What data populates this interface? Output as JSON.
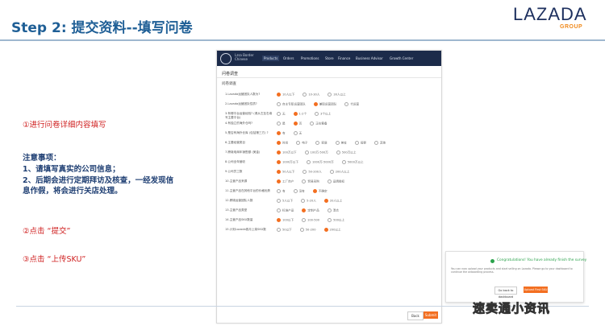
{
  "slide": {
    "title": "Step 2: 提交资料--填写问卷",
    "logo_word": "LAZADA",
    "logo_sub": "GROUP",
    "step1": "①进行问卷详细内容填写",
    "notes_heading": "注意事项：",
    "note1": "1、请填写真实的公司信息；",
    "note2_line1": "2、后期会进行定期拜访及核查，一经发现信",
    "note2_line2": "息作假，将会进行关店处理。",
    "step2": "②点击 “提交”",
    "step3": "③点击 “上传SKU”",
    "watermark": "速卖通小资讯"
  },
  "screenshot": {
    "shop_name_line1": "Lzsa Border",
    "shop_name_line2": "Chinese",
    "nav": [
      {
        "label": "Products",
        "active": true
      },
      {
        "label": "Orders",
        "active": false
      },
      {
        "label": "Promotions",
        "active": false
      },
      {
        "label": "Store",
        "active": false
      },
      {
        "label": "Finance",
        "active": false
      },
      {
        "label": "Business Advisor",
        "active": false
      },
      {
        "label": "Growth Center",
        "active": false
      }
    ],
    "page_title": "问卷调查",
    "section_title": "问卷调查",
    "questions": [
      {
        "label": "1.Lazada运营团队人数为?",
        "options": [
          "10人以下",
          "10-30人",
          "30人以上"
        ],
        "selected": 0
      },
      {
        "label": "2.Lazada运营团队性质?",
        "options": [
          "自主专职运营团队",
          "兼职运营团队",
          "代运营"
        ],
        "selected": 1
      },
      {
        "label": "3.有哪平台运营经验? (请从左至右填写主要平台)",
        "options": [
          "无",
          "1-2个",
          "3个以上"
        ],
        "selected": 1
      },
      {
        "label": "4.有独立的海外仓吗?",
        "options": [
          "是",
          "否",
          "正在筹备"
        ],
        "selected": 1
      },
      {
        "label": "5.是否有海外仓库 (包括第三方) ?",
        "options": [
          "有",
          "无"
        ],
        "selected": 0
      },
      {
        "label": "6.主要经营类目",
        "options": [
          "时尚",
          "电子",
          "家居",
          "美妆",
          "母婴",
          "其他"
        ],
        "selected": 0
      },
      {
        "label": "7.跨境电商年销售额 (美金)",
        "options": [
          "100万以下",
          "100万-500万",
          "500万以上"
        ],
        "selected": 0
      },
      {
        "label": "8.公司全年营收",
        "options": [
          "1000万以下",
          "1000万-5000万",
          "5000万以上"
        ],
        "selected": 0
      },
      {
        "label": "9.公司员工数",
        "options": [
          "50人以下",
          "50-200人",
          "200人以上"
        ],
        "selected": 0
      },
      {
        "label": "10.主营产品来源",
        "options": [
          "工厂自产",
          "贸易采购",
          "品牌授权"
        ],
        "selected": 0
      },
      {
        "label": "11.主营产品在其他平台的价格优势",
        "options": [
          "有",
          "没有",
          "不确定"
        ],
        "selected": 2
      },
      {
        "label": "12.跨境运营团队人数",
        "options": [
          "5人以下",
          "5-20人",
          "20人以上"
        ],
        "selected": 2
      },
      {
        "label": "13.主营产品类型",
        "options": [
          "标准产品",
          "定制产品",
          "混合"
        ],
        "selected": 1
      },
      {
        "label": "14.主营产品SKU数量",
        "options": [
          "100以下",
          "100-500",
          "500以上"
        ],
        "selected": 0
      },
      {
        "label": "15.计划Lazada首月上架SKU数",
        "options": [
          "50以下",
          "50-200",
          "200以上"
        ],
        "selected": 2
      }
    ],
    "back_label": "Back",
    "submit_label": "Submit"
  },
  "dialog": {
    "message": "Congratulations! You have already finish the survey",
    "description": "You can now upload your products and start selling on Lazada. Please go to your dashboard to continue the onboarding process.",
    "back_button": "Go back to dashboard",
    "upload_button": "Upload First SKU"
  },
  "colors": {
    "title_blue": "#1f5f96",
    "lazada_navy": "#1c2f5e",
    "accent_orange": "#f36f21",
    "step_red": "#cf1f1f",
    "notes_navy": "#1f3f73",
    "success_green": "#2ba24c"
  }
}
